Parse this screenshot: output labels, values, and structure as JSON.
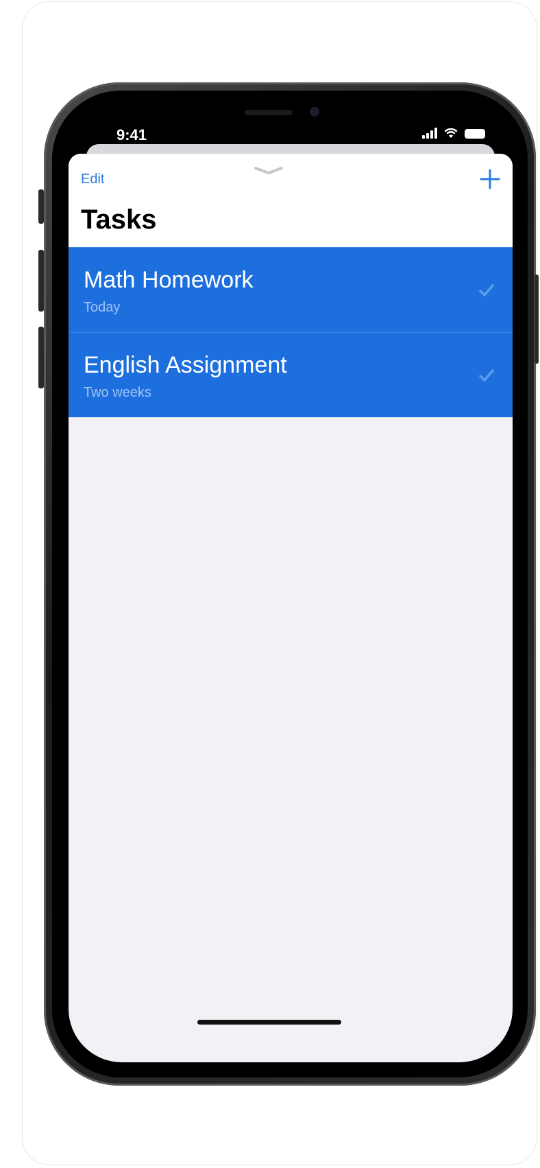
{
  "status_bar": {
    "time": "9:41",
    "signal_icon": "signal-icon",
    "wifi_icon": "wifi-icon",
    "battery_icon": "battery-icon"
  },
  "nav": {
    "edit_label": "Edit",
    "add_icon": "plus-icon",
    "title": "Tasks"
  },
  "tasks": [
    {
      "title": "Math Homework",
      "due": "Today",
      "checkmark_icon": "checkmark-icon"
    },
    {
      "title": "English Assignment",
      "due": "Two weeks",
      "checkmark_icon": "checkmark-icon"
    }
  ],
  "colors": {
    "accent": "#2a7ae2",
    "row_background": "#1e6fde",
    "sheet_background": "#f1f1f6"
  }
}
